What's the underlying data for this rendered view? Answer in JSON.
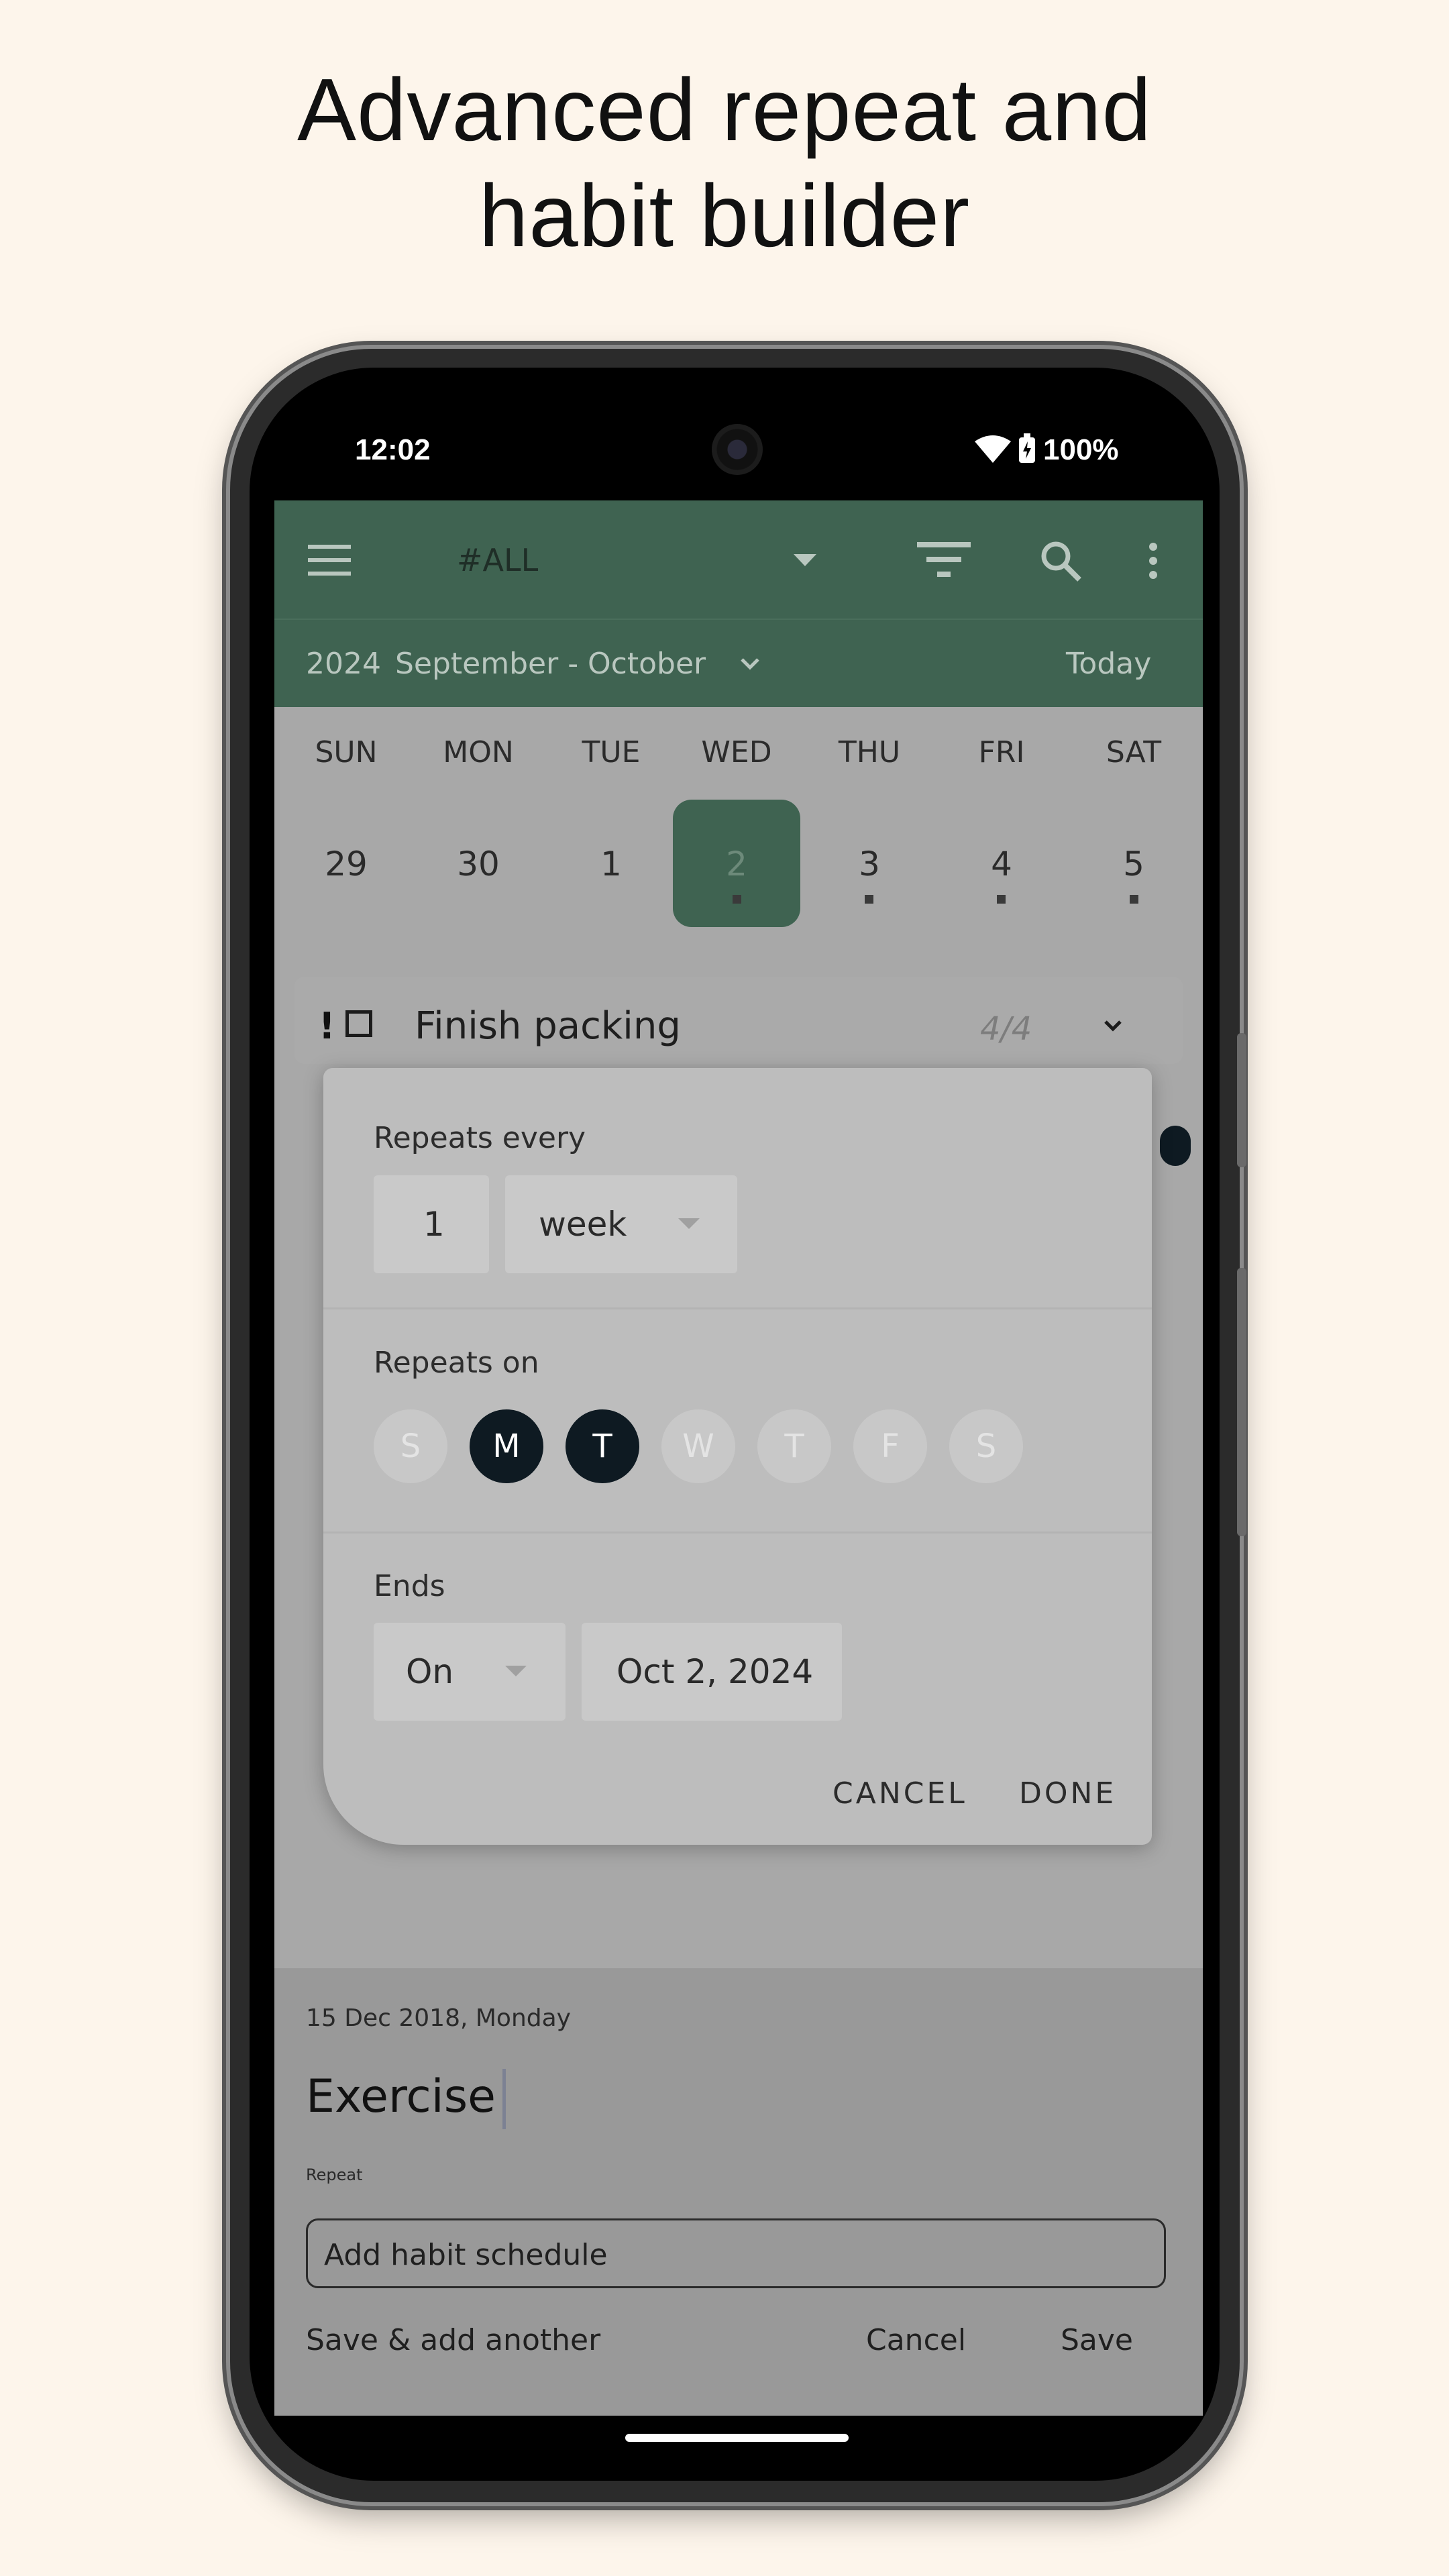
{
  "headline": {
    "line1": "Advanced repeat and",
    "line2": "habit builder"
  },
  "statusbar": {
    "time": "12:02",
    "battery": "100%"
  },
  "appbar": {
    "filter_label": "#ALL"
  },
  "datebar": {
    "year": "2024",
    "range": "September - October",
    "today": "Today"
  },
  "calendar": {
    "weekdays": [
      "SUN",
      "MON",
      "TUE",
      "WED",
      "THU",
      "FRI",
      "SAT"
    ],
    "days": [
      "29",
      "30",
      "1",
      "2",
      "3",
      "4",
      "5"
    ]
  },
  "task": {
    "priority": "!",
    "title": "Finish packing",
    "count": "4/4"
  },
  "repeat_dialog": {
    "repeats_every_label": "Repeats every",
    "interval_value": "1",
    "unit_value": "week",
    "repeats_on_label": "Repeats on",
    "days": [
      "S",
      "M",
      "T",
      "W",
      "T",
      "F",
      "S"
    ],
    "ends_label": "Ends",
    "ends_mode": "On",
    "ends_date": "Oct 2, 2024",
    "cancel": "CANCEL",
    "done": "DONE"
  },
  "sheet": {
    "date": "15 Dec 2018, Monday",
    "title": "Exercise",
    "repeat_label": "Repeat",
    "habit_placeholder": "Add habit schedule",
    "save_add_another": "Save & add another",
    "cancel": "Cancel",
    "save": "Save"
  },
  "colors": {
    "app_green": "#3f6351",
    "selected_day": "#0e1a22",
    "background": "#fdf5eb"
  }
}
